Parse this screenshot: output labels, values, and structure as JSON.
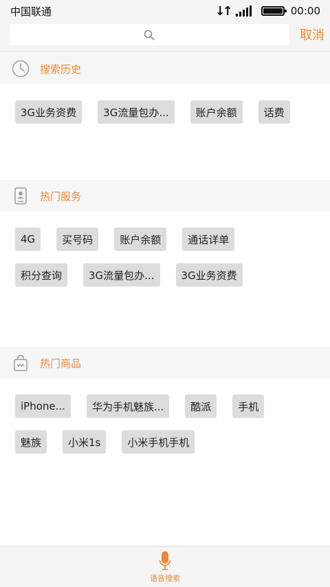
{
  "status_bar": {
    "carrier": "中国联通",
    "time": "00:00"
  },
  "search": {
    "placeholder": "",
    "cancel_label": "取消"
  },
  "sections": {
    "history": {
      "title": "搜索历史",
      "tags": [
        "3G业务资费",
        "3G流量包办...",
        "账户余额",
        "话费"
      ]
    },
    "hot_services": {
      "title": "热门服务",
      "tags": [
        "4G",
        "买号码",
        "账户余额",
        "通话详单",
        "积分查询",
        "3G流量包办...",
        "3G业务资费"
      ]
    },
    "hot_products": {
      "title": "热门商品",
      "tags": [
        "iPhone...",
        "华为手机魅族...",
        "酷派",
        "手机",
        "魅族",
        "小米1s",
        "小米手机手机"
      ]
    }
  },
  "voice_search": {
    "label": "语音搜索"
  },
  "colors": {
    "accent": "#e8893a",
    "tag_bg": "#dcdcdc",
    "section_bg": "#f6f6f6"
  },
  "icons": {
    "history": "clock-icon",
    "hot_services": "contact-card-icon",
    "hot_products": "shopping-bag-icon",
    "search": "search-icon",
    "voice": "microphone-icon"
  }
}
